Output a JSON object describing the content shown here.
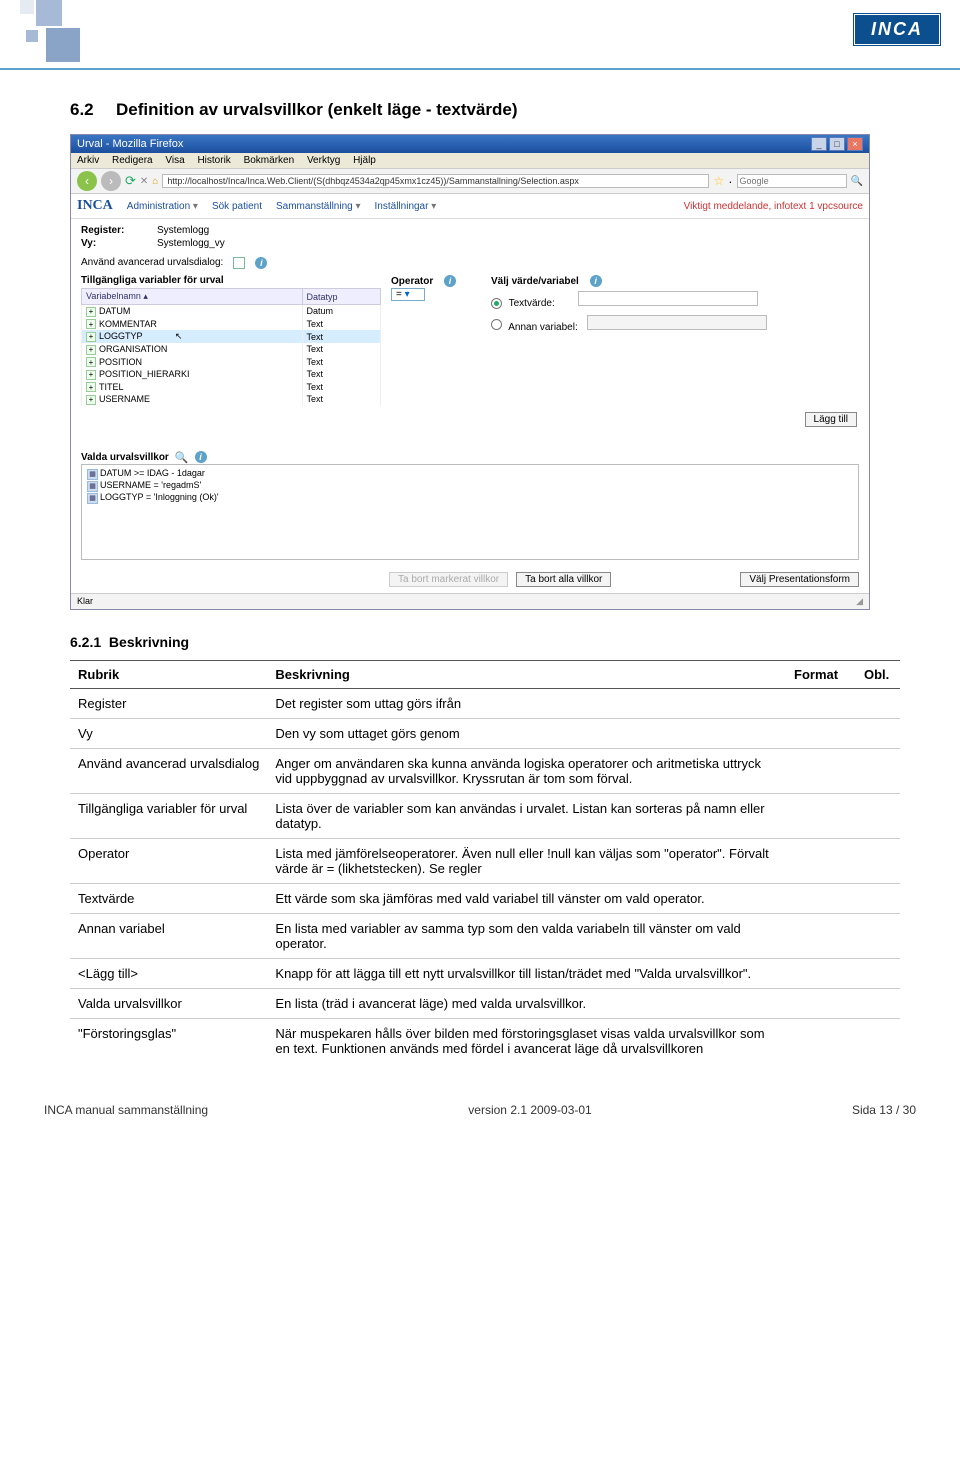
{
  "branding": {
    "logo_text": "INCA"
  },
  "section": {
    "number": "6.2",
    "title": "Definition av urvalsvillkor (enkelt läge - textvärde)"
  },
  "subsection": {
    "number": "6.2.1",
    "title": "Beskrivning"
  },
  "browser": {
    "window_title": "Urval - Mozilla Firefox",
    "menu": [
      "Arkiv",
      "Redigera",
      "Visa",
      "Historik",
      "Bokmärken",
      "Verktyg",
      "Hjälp"
    ],
    "url": "http://localhost/Inca/Inca.Web.Client/(S(dhbqz4534a2qp45xmx1cz45))/Sammanstallning/Selection.aspx",
    "search_placeholder": "Google",
    "status": "Klar"
  },
  "app": {
    "logo": "INCA",
    "menu_items": [
      "Administration",
      "Sök patient",
      "Sammanställning",
      "Inställningar"
    ],
    "notice": "Viktigt meddelande, infotext 1 vpcsource",
    "register_label": "Register:",
    "register_value": "Systemlogg",
    "vy_label": "Vy:",
    "vy_value": "Systemlogg_vy",
    "advanced_label": "Använd avancerad urvalsdialog:",
    "variables_header": "Tillgängliga variabler för urval",
    "col_name": "Variabelnamn ▴",
    "col_type": "Datatyp",
    "variables": [
      {
        "name": "DATUM",
        "type": "Datum",
        "sel": false
      },
      {
        "name": "KOMMENTAR",
        "type": "Text",
        "sel": false
      },
      {
        "name": "LOGGTYP",
        "type": "Text",
        "sel": true
      },
      {
        "name": "ORGANISATION",
        "type": "Text",
        "sel": false
      },
      {
        "name": "POSITION",
        "type": "Text",
        "sel": false
      },
      {
        "name": "POSITION_HIERARKI",
        "type": "Text",
        "sel": false
      },
      {
        "name": "TITEL",
        "type": "Text",
        "sel": false
      },
      {
        "name": "USERNAME",
        "type": "Text",
        "sel": false
      }
    ],
    "operator_label": "Operator",
    "operator_value": "=",
    "valj_label": "Välj värde/variabel",
    "textvarde_label": "Textvärde:",
    "annan_label": "Annan variabel:",
    "lagg_till": "Lägg till",
    "valda_label": "Valda urvalsvillkor",
    "valda_items": [
      "DATUM >= IDAG - 1dagar",
      "USERNAME = 'regadmS'",
      "LOGGTYP = 'Inloggning (Ok)'"
    ],
    "btn_remove_sel": "Ta bort markerat villkor",
    "btn_remove_all": "Ta bort alla villkor",
    "btn_presentation": "Välj Presentationsform"
  },
  "table": {
    "headers": {
      "rubrik": "Rubrik",
      "beskrivning": "Beskrivning",
      "format": "Format",
      "obl": "Obl."
    },
    "rows": [
      {
        "r": "Register",
        "b": "Det register som uttag görs ifrån"
      },
      {
        "r": "Vy",
        "b": "Den vy som uttaget görs genom"
      },
      {
        "r": "Använd avancerad urvalsdialog",
        "b": "Anger om användaren ska kunna använda logiska operatorer och aritmetiska uttryck vid uppbyggnad av urvalsvillkor. Kryssrutan är tom som förval."
      },
      {
        "r": "Tillgängliga variabler för urval",
        "b": "Lista över de variabler som kan användas i urvalet. Listan kan sorteras på namn eller datatyp."
      },
      {
        "r": "Operator",
        "b": "Lista med jämförelseoperatorer. Även null eller !null kan väljas som \"operator\". Förvalt värde är = (likhetstecken). Se regler"
      },
      {
        "r": "Textvärde",
        "b": "Ett värde som ska jämföras med vald variabel till vänster om vald operator."
      },
      {
        "r": "Annan variabel",
        "b": "En lista med variabler av samma typ som den valda variabeln till vänster om vald operator."
      },
      {
        "r": "<Lägg till>",
        "b": "Knapp för att lägga till ett nytt urvalsvillkor till listan/trädet med \"Valda urvalsvillkor\"."
      },
      {
        "r": "Valda urvalsvillkor",
        "b": "En lista (träd i avancerat läge) med valda urvalsvillkor."
      },
      {
        "r": "\"Förstoringsglas\"",
        "b": "När muspekaren hålls över bilden med förstoringsglaset visas valda urvalsvillkor som en text. Funktionen används med fördel i avancerat läge då urvalsvillkoren"
      }
    ]
  },
  "footer": {
    "left": "INCA manual sammanställning",
    "center": "version 2.1  2009-03-01",
    "right": "Sida 13 / 30"
  }
}
